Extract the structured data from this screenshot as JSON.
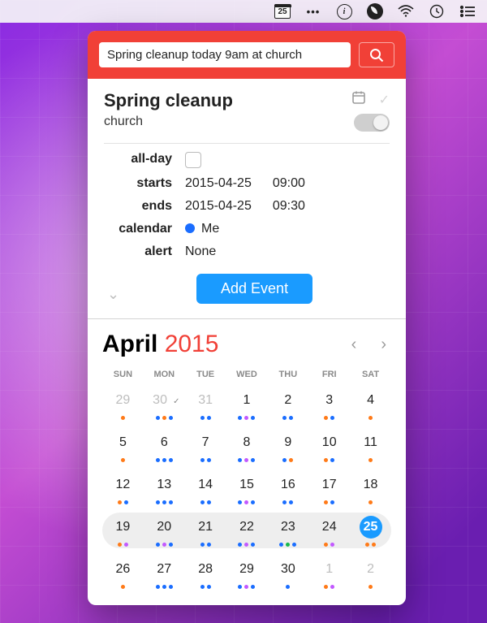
{
  "menubar": {
    "date": "25"
  },
  "colors": {
    "accent_red": "#f14037",
    "accent_blue": "#1a9bff",
    "dot_orange": "#ff7a18",
    "dot_blue": "#1a6dff",
    "dot_purple": "#c259ff",
    "dot_green": "#18b84c"
  },
  "search": {
    "placeholder": "",
    "value": "Spring cleanup today 9am at church"
  },
  "event": {
    "title": "Spring cleanup",
    "location": "church",
    "fields": {
      "allday_label": "all-day",
      "starts_label": "starts",
      "starts_date": "2015-04-25",
      "starts_time": "09:00",
      "ends_label": "ends",
      "ends_date": "2015-04-25",
      "ends_time": "09:30",
      "calendar_label": "calendar",
      "calendar_name": "Me",
      "calendar_color": "#1a6dff",
      "alert_label": "alert",
      "alert_value": "None"
    },
    "add_button": "Add Event"
  },
  "calendar": {
    "month": "April",
    "year": "2015",
    "weekdays": [
      "SUN",
      "MON",
      "TUE",
      "WED",
      "THU",
      "FRI",
      "SAT"
    ],
    "today": 25,
    "current_week_start": 19,
    "days": [
      {
        "n": 29,
        "other": true,
        "dots": [
          "o"
        ]
      },
      {
        "n": 30,
        "other": true,
        "dots": [
          "b",
          "o",
          "b"
        ],
        "check": true
      },
      {
        "n": 31,
        "other": true,
        "dots": [
          "b",
          "b"
        ]
      },
      {
        "n": 1,
        "dots": [
          "b",
          "p",
          "b"
        ]
      },
      {
        "n": 2,
        "dots": [
          "b",
          "b"
        ]
      },
      {
        "n": 3,
        "dots": [
          "o",
          "b"
        ]
      },
      {
        "n": 4,
        "dots": [
          "o"
        ]
      },
      {
        "n": 5,
        "dots": [
          "o"
        ]
      },
      {
        "n": 6,
        "dots": [
          "b",
          "b",
          "b"
        ]
      },
      {
        "n": 7,
        "dots": [
          "b",
          "b"
        ]
      },
      {
        "n": 8,
        "dots": [
          "b",
          "p",
          "b"
        ]
      },
      {
        "n": 9,
        "dots": [
          "b",
          "o"
        ]
      },
      {
        "n": 10,
        "dots": [
          "o",
          "b"
        ]
      },
      {
        "n": 11,
        "dots": [
          "o"
        ]
      },
      {
        "n": 12,
        "dots": [
          "o",
          "b"
        ]
      },
      {
        "n": 13,
        "dots": [
          "b",
          "b",
          "b"
        ]
      },
      {
        "n": 14,
        "dots": [
          "b",
          "b"
        ]
      },
      {
        "n": 15,
        "dots": [
          "b",
          "p",
          "b"
        ]
      },
      {
        "n": 16,
        "dots": [
          "b",
          "b"
        ]
      },
      {
        "n": 17,
        "dots": [
          "o",
          "b"
        ]
      },
      {
        "n": 18,
        "dots": [
          "o"
        ]
      },
      {
        "n": 19,
        "dots": [
          "o",
          "p"
        ]
      },
      {
        "n": 20,
        "dots": [
          "b",
          "p",
          "b"
        ]
      },
      {
        "n": 21,
        "dots": [
          "b",
          "b"
        ]
      },
      {
        "n": 22,
        "dots": [
          "b",
          "p",
          "b"
        ]
      },
      {
        "n": 23,
        "dots": [
          "b",
          "g",
          "b"
        ]
      },
      {
        "n": 24,
        "dots": [
          "o",
          "p"
        ]
      },
      {
        "n": 25,
        "dots": [
          "o",
          "o"
        ]
      },
      {
        "n": 26,
        "dots": [
          "o"
        ]
      },
      {
        "n": 27,
        "dots": [
          "b",
          "b",
          "b"
        ]
      },
      {
        "n": 28,
        "dots": [
          "b",
          "b"
        ]
      },
      {
        "n": 29,
        "dots": [
          "b",
          "p",
          "b"
        ]
      },
      {
        "n": 30,
        "dots": [
          "b"
        ]
      },
      {
        "n": 1,
        "other": true,
        "dots": [
          "o",
          "p"
        ]
      },
      {
        "n": 2,
        "other": true,
        "dots": [
          "o"
        ]
      }
    ]
  }
}
